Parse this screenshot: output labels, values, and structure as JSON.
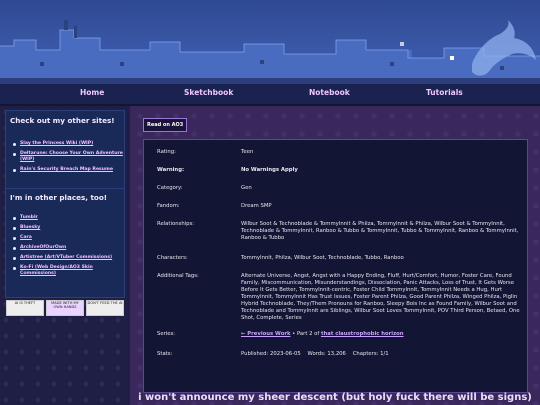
{
  "nav": {
    "home": "Home",
    "sketchbook": "Sketchbook",
    "notebook": "Notebook",
    "tutorials": "Tutorials"
  },
  "sidebar": {
    "sites_title": "Check out my other sites!",
    "sites": [
      "Slay the Princess Wiki (WIP)",
      "Deltarune: Choose Your Own Adventure (WIP)",
      "Rain's Security Breach Map Resume"
    ],
    "places_title": "I'm in other places, too!",
    "places": [
      "Tumblr",
      "Bluesky",
      "Cara",
      "ArchiveOfOurOwn",
      "Artistree (Art/VTuber Commissions)",
      "Ko-Fi (Web Design/AO3 Skin Commissions)"
    ],
    "badges": [
      "AI IS THEFT",
      "MADE WITH MY OWN HANDS",
      "DON'T FEED THE AI"
    ]
  },
  "work": {
    "read_button": "Read on AO3",
    "rating_label": "Rating:",
    "rating": "Teen",
    "warning_label": "Warning:",
    "warning": "No Warnings Apply",
    "category_label": "Category:",
    "category": "Gen",
    "fandom_label": "Fandom:",
    "fandom": "Dream SMP",
    "relationships_label": "Relationships:",
    "relationships": "Wilbur Soot & Technoblade & TommyInnit & Philza, TommyInnit & Philza, Wilbur Soot & TommyInnit, Technoblade & TommyInnit, Ranboo & Tubbo & TommyInnit, Tubbo & TommyInnit, Ranboo & TommyInnit, Ranboo & Tubbo",
    "characters_label": "Characters:",
    "characters": "TommyInnit, Philza, Wilbur Soot, Technoblade, Tubbo, Ranboo",
    "tags_label": "Additional Tags:",
    "tags": "Alternate Universe, Angst, Angst with a Happy Ending, Fluff, Hurt/Comfort, Humor, Foster Care, Found Family, Miscommunication, Misunderstandings, Dissociation, Panic Attacks, Loss of Trust, It Gets Worse Before It Gets Better, TommyInnit-centric, Foster Child TommyInnit, TommyInnit Needs a Hug, Hurt TommyInnit, TommyInnit Has Trust Issues, Foster Parent Philza, Good Parent Philza, Winged Philza, Piglin Hybrid Technoblade, They/Them Pronouns for Ranboo, Sleepy Bois Inc as Found Family, Wilbur Soot and Technoblade and TommyInnit are Siblings, Wilbur Soot Loves TommyInnit, POV Third Person, Betaed, One Shot, Complete, Series",
    "series_label": "Series:",
    "series_prev": "← Previous Work",
    "series_mid": " • Part 2 of ",
    "series_name": "that claustrophobic horizon",
    "stats_label": "Stats:",
    "published_label": "Published:",
    "published": "2023-06-05",
    "words_label": "Words:",
    "words": "13,206",
    "chapters_label": "Chapters:",
    "chapters": "1/1",
    "title": "i won't announce my sheer descent (but holy fuck there will be signs)"
  }
}
